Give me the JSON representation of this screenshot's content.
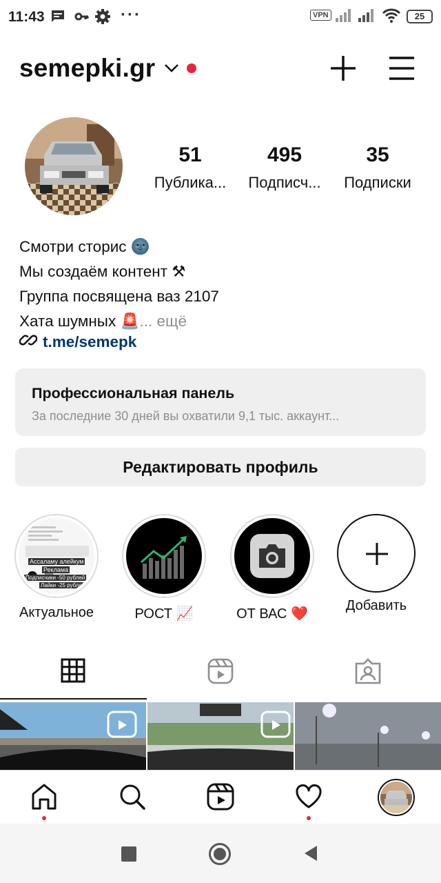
{
  "status_bar": {
    "time": "11:43",
    "left_icons": [
      "message-icon",
      "key-icon",
      "gear-icon",
      "more-dots-icon"
    ],
    "vpn_label": "VPN",
    "battery": "25"
  },
  "header": {
    "username": "semepki.gr"
  },
  "stats": [
    {
      "value": "51",
      "label": "Публика..."
    },
    {
      "value": "495",
      "label": "Подписч..."
    },
    {
      "value": "35",
      "label": "Подписки"
    }
  ],
  "bio": {
    "line1": "Смотри сторис 🌚",
    "line2": "Мы создаём контент ⚒",
    "line3": "Группа посвящена ваз 2107",
    "line4": "Хата шумных 🚨",
    "more": "... ещё",
    "link": "t.me/semepk"
  },
  "pro_panel": {
    "title": "Профессиональная панель",
    "subtitle": "За последние 30 дней вы охватили 9,1 тыс. аккаунт..."
  },
  "edit_button": "Редактировать профиль",
  "highlights": [
    {
      "label": "Актуальное"
    },
    {
      "label": "РОСТ 📈"
    },
    {
      "label": "ОТ ВАС ❤️"
    },
    {
      "label": "Добавить"
    }
  ],
  "highlight_thumb_text": {
    "line1": "Ассаламу алейкум",
    "line2": "Реклама",
    "line3": "Подписчики -50 рублей",
    "line4": "Лайки -25 рублей"
  },
  "colors": {
    "accent_red": "#ed2140",
    "link_blue": "#00376b",
    "panel_gray": "#efefef",
    "muted_text": "#8e8e8e"
  }
}
